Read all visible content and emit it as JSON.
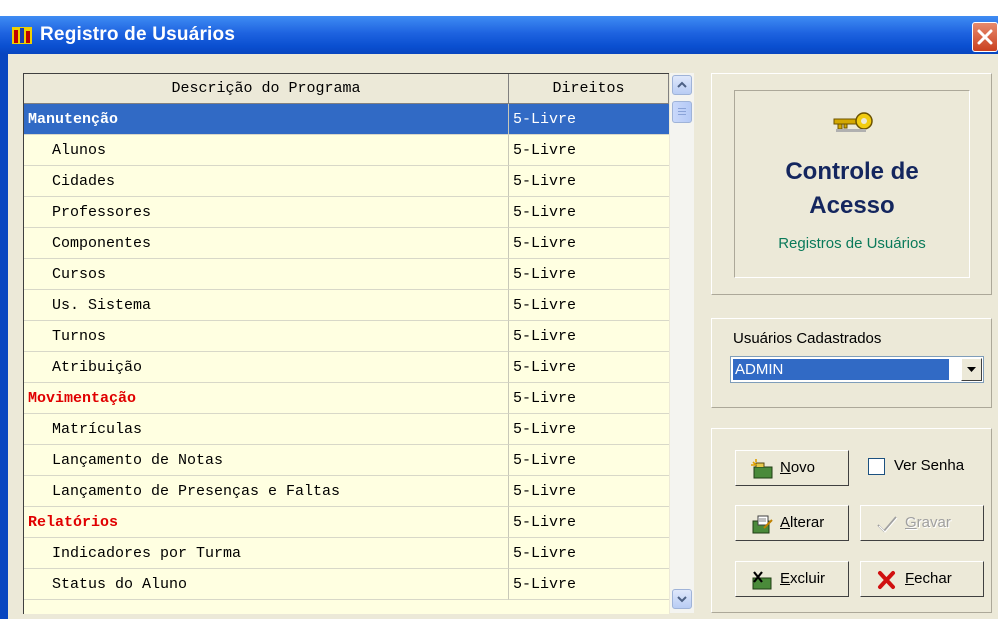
{
  "window": {
    "title": "Registro de Usuários"
  },
  "grid": {
    "columns": [
      "Descrição do Programa",
      "Direitos"
    ],
    "rows": [
      {
        "name": "Manutenção",
        "rights": "5-Livre",
        "type": "group",
        "selected": true
      },
      {
        "name": "Alunos",
        "rights": "5-Livre",
        "type": "sub"
      },
      {
        "name": "Cidades",
        "rights": "5-Livre",
        "type": "sub"
      },
      {
        "name": "Professores",
        "rights": "5-Livre",
        "type": "sub"
      },
      {
        "name": "Componentes",
        "rights": "5-Livre",
        "type": "sub"
      },
      {
        "name": "Cursos",
        "rights": "5-Livre",
        "type": "sub"
      },
      {
        "name": "Us. Sistema",
        "rights": "5-Livre",
        "type": "sub"
      },
      {
        "name": "Turnos",
        "rights": "5-Livre",
        "type": "sub"
      },
      {
        "name": "Atribuição",
        "rights": "5-Livre",
        "type": "sub"
      },
      {
        "name": "Movimentação",
        "rights": "5-Livre",
        "type": "group"
      },
      {
        "name": "Matrículas",
        "rights": "5-Livre",
        "type": "sub"
      },
      {
        "name": "Lançamento de Notas",
        "rights": "5-Livre",
        "type": "sub"
      },
      {
        "name": "Lançamento de Presenças e Faltas",
        "rights": "5-Livre",
        "type": "sub"
      },
      {
        "name": "Relatórios",
        "rights": "5-Livre",
        "type": "group"
      },
      {
        "name": "Indicadores por Turma",
        "rights": "5-Livre",
        "type": "sub"
      },
      {
        "name": "Status do Aluno",
        "rights": "5-Livre",
        "type": "sub"
      }
    ]
  },
  "logo": {
    "title_line1": "Controle de",
    "title_line2": "Acesso",
    "subtitle": "Registros de Usuários"
  },
  "users": {
    "label": "Usuários Cadastrados",
    "selected": "ADMIN"
  },
  "buttons": {
    "novo": "Novo",
    "ver_senha": "Ver Senha",
    "alterar": "Alterar",
    "gravar": "Gravar",
    "excluir": "Excluir",
    "fechar": "Fechar"
  },
  "colors": {
    "selection": "#316ac5",
    "group_text": "#e00000",
    "grid_bg": "#ffffe1",
    "logo_title": "#14265e",
    "logo_sub": "#0a7a5a"
  }
}
